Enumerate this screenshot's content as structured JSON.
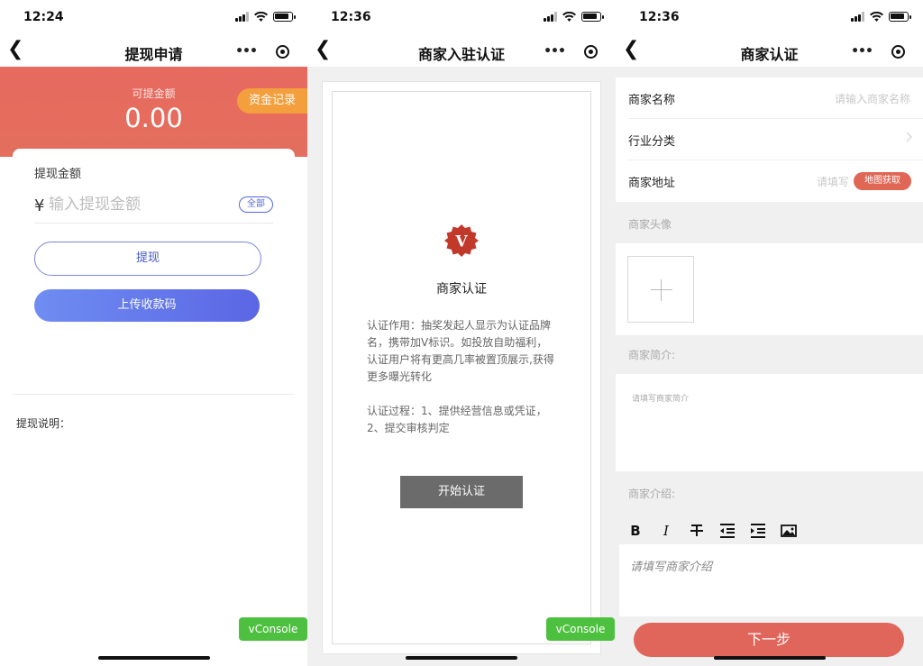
{
  "panel1": {
    "time": "12:24",
    "title": "提现申请",
    "available_label": "可提金额",
    "available_amount": "0.00",
    "record_button": "资金记录",
    "amount_heading": "提现金额",
    "currency_symbol": "¥",
    "amount_placeholder": "输入提现金额",
    "all_button": "全部",
    "withdraw_button": "提现",
    "upload_button": "上传收款码",
    "note_label": "提现说明：",
    "vconsole": "vConsole"
  },
  "panel2": {
    "time": "12:36",
    "title": "商家入驻认证",
    "badge_letter": "V",
    "modal_title": "商家认证",
    "para1": "认证作用：抽奖发起人显示为认证品牌名，携带加V标识。如投放自助福利，认证用户将有更高几率被置顶展示,获得更多曝光转化",
    "para2": "认证过程：1、提供经营信息或凭证，2、提交审核判定",
    "start_button": "开始认证",
    "vconsole": "vConsole"
  },
  "panel3": {
    "time": "12:36",
    "title": "商家认证",
    "name_label": "商家名称",
    "name_placeholder": "请输入商家名称",
    "industry_label": "行业分类",
    "address_label": "商家地址",
    "address_placeholder": "请填写",
    "map_button": "地图获取",
    "avatar_label": "商家头像",
    "brief_label": "商家简介:",
    "brief_placeholder": "请填写商家简介",
    "intro_label": "商家介绍:",
    "editor_placeholder": "请填写商家介绍",
    "next_button": "下一步"
  },
  "colors": {
    "banner": "#e7695f",
    "record_button": "#f49f3d",
    "primary_blue": "#5b66e4",
    "vconsole_green": "#4ec040",
    "badge_red": "#c0392b",
    "next_red": "#e0655a"
  },
  "icons": [
    "back-chevron-icon",
    "more-dots-icon",
    "record-circle-icon",
    "signal-icon",
    "wifi-icon",
    "battery-icon",
    "plus-icon",
    "bold-icon",
    "italic-icon",
    "strikethrough-icon",
    "outdent-icon",
    "indent-icon",
    "image-icon"
  ]
}
